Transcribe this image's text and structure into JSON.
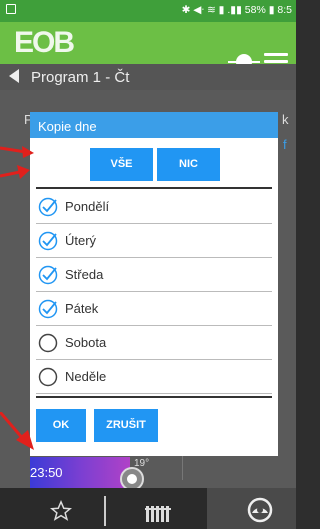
{
  "status_bar": {
    "right_text": "✱ ◀ᐧ ≋ ▮ .▮▮ 58% ▮ 8:5"
  },
  "app_bar": {
    "logo": "EOB"
  },
  "nav": {
    "title": "Program 1 - Čt"
  },
  "background": {
    "fragment_left": "P",
    "fragment_right": "k",
    "fragment_bracket": "f",
    "time": "23:50",
    "temperature": "19°"
  },
  "dialog": {
    "title": "Kopie dne",
    "all_label": "VŠE",
    "none_label": "NIC",
    "days": [
      {
        "label": "Pondělí",
        "checked": true
      },
      {
        "label": "Úterý",
        "checked": true
      },
      {
        "label": "Středa",
        "checked": true
      },
      {
        "label": "Pátek",
        "checked": true
      },
      {
        "label": "Sobota",
        "checked": false
      },
      {
        "label": "Neděle",
        "checked": false
      }
    ],
    "ok_label": "OK",
    "cancel_label": "ZRUŠIT"
  },
  "colors": {
    "accent": "#2196f3",
    "app_bar": "#6cbf45",
    "annotation_arrow": "#e0201c"
  }
}
